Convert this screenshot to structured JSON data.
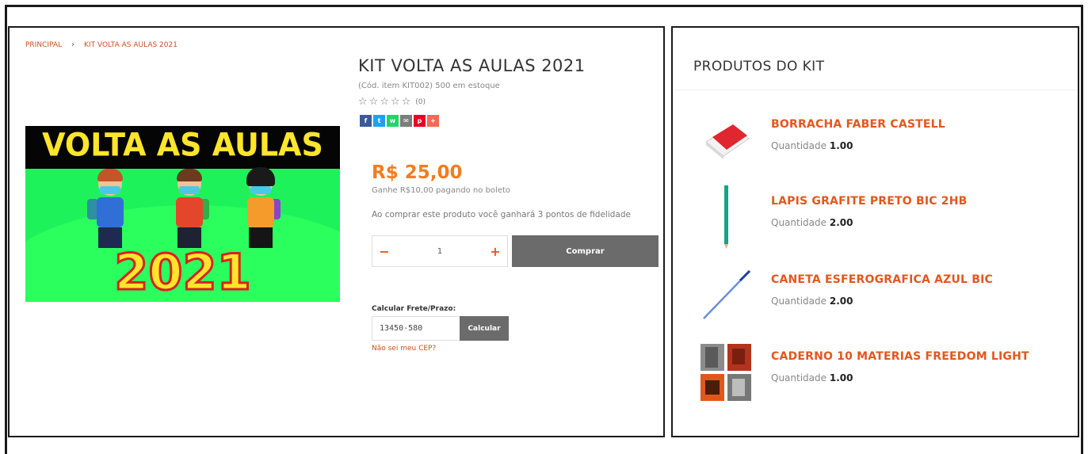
{
  "breadcrumb": {
    "home": "PRINCIPAL",
    "separator": "›",
    "current": "KIT VOLTA AS AULAS 2021"
  },
  "banner": {
    "headline": "VOLTA AS AULAS",
    "year": "2021",
    "colors": {
      "background": "#1ef25b",
      "text": "#ffe52b",
      "outline": "#d8231f",
      "bar": "#050505"
    }
  },
  "product": {
    "title": "KIT VOLTA AS AULAS 2021",
    "code_line": "(Cód. item KIT002) 500 em estoque",
    "rating_count": "(0)",
    "stars": [
      "☆",
      "☆",
      "☆",
      "☆",
      "☆"
    ],
    "price": "R$ 25,00",
    "installment": "Ganhe R$10,00 pagando no boleto",
    "loyalty": "Ao comprar este produto você ganhará 3 pontos de fidelidade",
    "quantity": "1",
    "minus": "−",
    "plus": "+",
    "buy_label": "Comprar"
  },
  "social": [
    {
      "icon": "facebook-icon",
      "glyph": "f",
      "color": "#3b5998"
    },
    {
      "icon": "twitter-icon",
      "glyph": "t",
      "color": "#1da1f2"
    },
    {
      "icon": "whatsapp-icon",
      "glyph": "w",
      "color": "#25d366"
    },
    {
      "icon": "email-icon",
      "glyph": "✉",
      "color": "#7d7d7d"
    },
    {
      "icon": "pinterest-icon",
      "glyph": "p",
      "color": "#e60023"
    },
    {
      "icon": "share-icon",
      "glyph": "+",
      "color": "#f06c55"
    }
  ],
  "freight": {
    "label": "Calcular Frete/Prazo:",
    "cep_value": "13450-580",
    "button": "Calcular",
    "link": "Não sei meu CEP?"
  },
  "kit": {
    "heading": "PRODUTOS DO KIT",
    "quantity_label": "Quantidade",
    "items": [
      {
        "name": "BORRACHA FABER CASTELL",
        "quantity": "1.00",
        "icon": "eraser-icon"
      },
      {
        "name": "LAPIS GRAFITE PRETO BIC 2HB",
        "quantity": "2.00",
        "icon": "pencil-icon"
      },
      {
        "name": "CANETA ESFEROGRAFICA AZUL BIC",
        "quantity": "2.00",
        "icon": "pen-icon"
      },
      {
        "name": "CADERNO 10 MATERIAS FREEDOM LIGHT",
        "quantity": "1.00",
        "icon": "notebook-icon"
      }
    ]
  }
}
